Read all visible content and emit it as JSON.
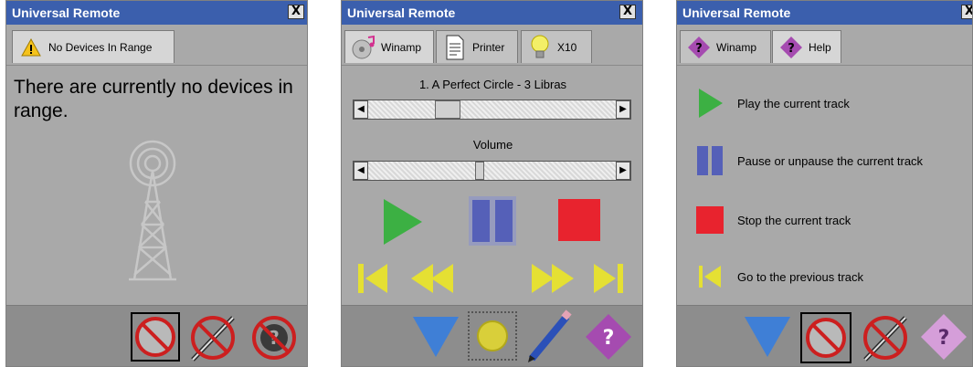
{
  "windows": [
    {
      "title": "Universal Remote",
      "close_label": "X",
      "tab_label": "No Devices In Range",
      "message": "There are currently no devices in range."
    },
    {
      "title": "Universal Remote",
      "close_label": "X",
      "tabs": [
        {
          "label": "Winamp"
        },
        {
          "label": "Printer"
        },
        {
          "label": "X10"
        }
      ],
      "track_label": "1. A Perfect Circle - 3 Libras",
      "volume_label": "Volume",
      "track_position": 0.3,
      "volume_position": 0.45
    },
    {
      "title": "Universal Remote",
      "close_label": "X",
      "tabs": [
        {
          "label": "Winamp"
        },
        {
          "label": "Help"
        }
      ],
      "help": [
        {
          "icon": "play-icon",
          "text": "Play the current track"
        },
        {
          "icon": "pause-icon",
          "text": "Pause or unpause the current track"
        },
        {
          "icon": "stop-icon",
          "text": "Stop the current track"
        },
        {
          "icon": "previous-track-icon",
          "text": "Go to the previous track"
        }
      ]
    }
  ],
  "colors": {
    "titlebar": "#3b5fad",
    "window_bg": "#a9a9a9",
    "play": "#3cb043",
    "pause": "#5560b8",
    "stop": "#e8232e",
    "nav": "#e5e033",
    "help_purple": "#a54bb0",
    "down_arrow": "#3f7fd6"
  }
}
